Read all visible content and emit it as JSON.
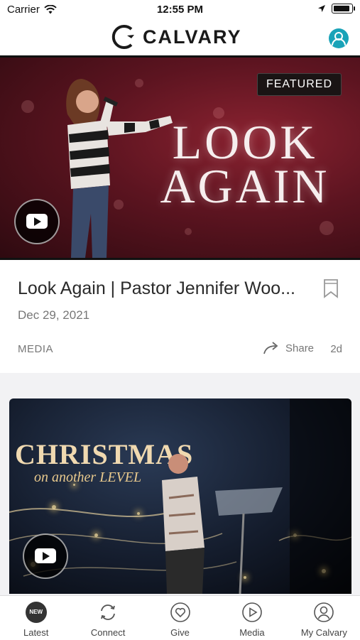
{
  "status_bar": {
    "carrier": "Carrier",
    "time": "12:55 PM"
  },
  "header": {
    "logo_text": "CALVARY"
  },
  "featured": {
    "badge": "FEATURED",
    "artwork_line1": "LOOK",
    "artwork_line2": "AGAIN",
    "title": "Look Again | Pastor Jennifer Woo...",
    "date": "Dec 29, 2021",
    "category": "MEDIA",
    "share_label": "Share",
    "age": "2d"
  },
  "second_card": {
    "artwork_title": "CHRISTMAS",
    "artwork_subtitle": "on another LEVEL"
  },
  "tabs": [
    {
      "label": "Latest",
      "icon": "new-badge-icon",
      "badge": "NEW"
    },
    {
      "label": "Connect",
      "icon": "sync-icon"
    },
    {
      "label": "Give",
      "icon": "heart-icon"
    },
    {
      "label": "Media",
      "icon": "play-icon"
    },
    {
      "label": "My Calvary",
      "icon": "person-icon"
    }
  ],
  "colors": {
    "accent": "#1aa3b8",
    "featured_bg": "#5c1420"
  }
}
